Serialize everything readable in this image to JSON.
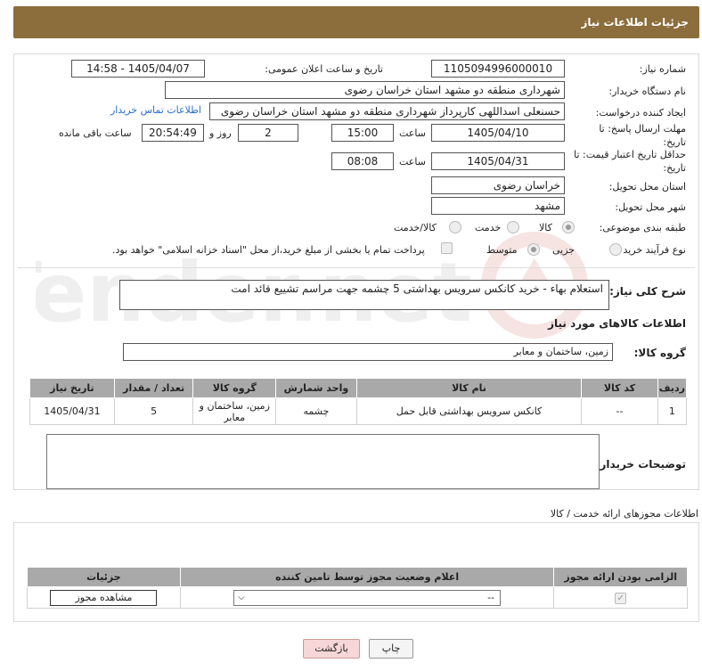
{
  "header": {
    "title": "جزئیات اطلاعات نیاز"
  },
  "form": {
    "need_number_label": "شماره نیاز:",
    "need_number": "1105094996000010",
    "announce_label": "تاریخ و ساعت اعلان عمومی:",
    "announce_value": "1405/04/07 - 14:58",
    "buyer_label": "نام دستگاه خریدار:",
    "buyer_value": "شهرداری منطقه دو مشهد استان خراسان رضوی",
    "creator_label": "ایجاد کننده درخواست:",
    "creator_value": "حسنعلی اسداللهی کارپرداز شهرداری منطقه دو مشهد استان خراسان رضوی",
    "contact_link": "اطلاعات تماس خریدار",
    "deadline_label": "مهلت ارسال پاسخ: تا تاریخ:",
    "deadline_date": "1405/04/10",
    "time_label": "ساعت",
    "deadline_time": "15:00",
    "days_value": "2",
    "days_label": "روز و",
    "remaining_time": "20:54:49",
    "remaining_label": "ساعت باقی مانده",
    "price_label": "حداقل تاریخ اعتبار قیمت: تا تاریخ:",
    "price_date": "1405/04/31",
    "price_time_label": "ساعت",
    "price_time": "08:08",
    "province_label": "استان محل تحویل:",
    "province_value": "خراسان رضوی",
    "city_label": "شهر محل تحویل:",
    "city_value": "مشهد",
    "category_label": "طبقه بندی موضوعی:",
    "category_options": [
      "کالا",
      "خدمت",
      "کالا/خدمت"
    ],
    "process_label": "نوع فرآیند خرید :",
    "process_options": [
      "جزیی",
      "متوسط"
    ],
    "payment_note": "پرداخت تمام یا بخشی از مبلغ خرید،از محل \"اسناد خزانه اسلامی\" خواهد بود.",
    "desc_label": "شرح کلی نیاز:",
    "desc_value": "استعلام بهاء - خرید کانکس سرویس بهداشتی 5 چشمه جهت مراسم تشییع قائد امت",
    "goods_info_label": "اطلاعات کالاهای مورد نیاز",
    "goods_group_label": "گروه کالا:",
    "goods_group_value": "زمین، ساختمان و معابر",
    "buyer_notes_label": "توضیحات خریدار:"
  },
  "items_table": {
    "headers": [
      "ردیف",
      "کد کالا",
      "نام کالا",
      "واحد شمارش",
      "گروه کالا",
      "تعداد / مقدار",
      "تاریخ نیاز"
    ],
    "rows": [
      [
        "1",
        "--",
        "کانکس سرویس بهداشتی قابل حمل",
        "چشمه",
        "زمین، ساختمان و معابر",
        "5",
        "1405/04/31"
      ]
    ]
  },
  "licenses": {
    "section_label": "اطلاعات مجوزهای ارائه خدمت / کالا",
    "headers": [
      "الزامی بودن ارائه مجوز",
      "اعلام وضعیت مجوز توسط تامین کننده",
      "جزئیات"
    ],
    "select_value": "--",
    "view_button": "مشاهده مجوز"
  },
  "footer": {
    "print_button": "چاپ",
    "back_button": "بازگشت"
  },
  "watermark": {
    "text": "AriaTender.net"
  },
  "colors": {
    "header_bg": "#8c6d3c",
    "table_header_bg": "#a9a9a9",
    "link": "#2a6ec6",
    "back_button_bg": "#f6d6d6"
  }
}
